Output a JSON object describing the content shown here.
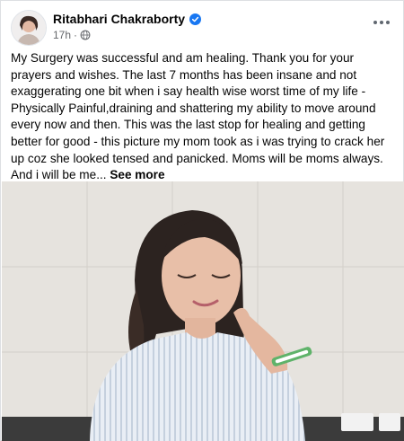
{
  "post": {
    "author_name": "Ritabhari Chakraborty",
    "time": "17h",
    "separator": "·",
    "audience_icon": "globe-icon",
    "verified_icon": "verified-badge-icon",
    "more_icon": "more-options-icon",
    "text": "My Surgery was successful and am healing. Thank you for your prayers and wishes. The last 7 months has been insane and not exaggerating one bit when i say health wise worst time of my life - Physically Painful,draining and shattering my ability to move around every now and then. This was the last stop for healing and getting better for good - this picture my mom took as i was trying to crack her up coz she looked tensed and panicked. Moms will be moms always. And i will be me...",
    "see_more_label": "See more"
  },
  "colors": {
    "verified_blue": "#1877f2",
    "meta_gray": "#65676b",
    "gown_stripes": "#c5d0de",
    "wall": "#e6e3de"
  }
}
